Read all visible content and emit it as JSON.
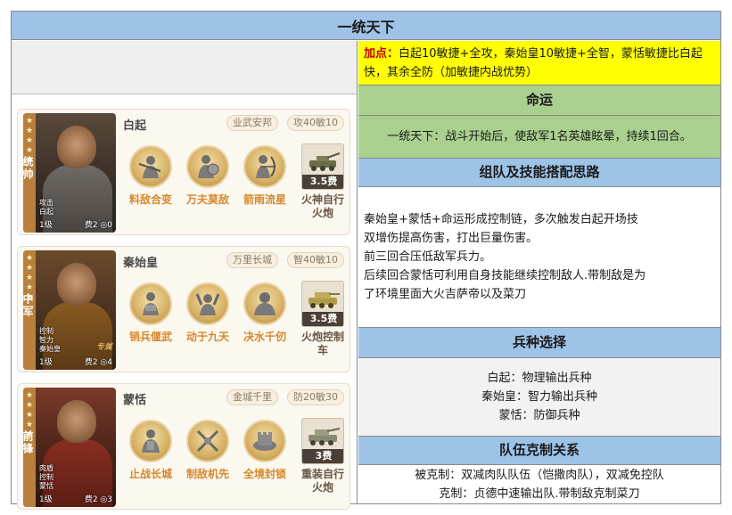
{
  "title": "一统天下",
  "right_panel": {
    "tip_prefix": "加点：",
    "tip_text": "白起10敏捷+全攻，秦始皇10敏捷+全智，蒙恬敏捷比白起快，其余全防（加敏捷内战优势）",
    "fate_header": "命运",
    "fate_text": "一统天下：战斗开始后，使敌军1名英雄眩晕，持续1回合。",
    "team_header": "组队及技能搭配思路",
    "team_lines": [
      "秦始皇+蒙恬+命运形成控制链，多次触发白起开场技",
      "双增伤提高伤害，打出巨量伤害。",
      "前三回合压低敌军兵力。",
      "后续回合蒙恬可利用自身技能继续控制敌人.带制敌是为",
      "了环境里面大火吉萨帝以及菜刀"
    ],
    "unit_header": "兵种选择",
    "unit_lines": [
      "白起：物理输出兵种",
      "秦始皇：智力输出兵种",
      "蒙恬：防御兵种"
    ],
    "counter_header": "队伍克制关系",
    "counter_lines": [
      "被克制：双减肉队队伍（恺撒肉队），双减免控队",
      "克制：贞德中速输出队.带制敌克制菜刀"
    ]
  },
  "heroes": [
    {
      "stars": "★\n★\n★\n★\n★",
      "role": "统帅",
      "portrait_text": "攻击\n白起",
      "level": "1级",
      "cost": "费2",
      "slot": "0",
      "tag": "",
      "name": "白起",
      "pill1": "业武安邦",
      "pill2": "攻40敏10",
      "skills": [
        "料敌合变",
        "万夫莫敌",
        "箭雨流星"
      ],
      "tank_cost": "3.5费",
      "tank_label": "火神自行火炮"
    },
    {
      "stars": "★\n★\n★\n★\n★",
      "role": "中军",
      "portrait_text": "控制\n智力\n秦始皇",
      "level": "1级",
      "cost": "费2",
      "slot": "4",
      "tag": "专属",
      "name": "秦始皇",
      "pill1": "万里长城",
      "pill2": "智40敏10",
      "skills": [
        "销兵偃武",
        "动于九天",
        "决水千仞"
      ],
      "tank_cost": "3.5费",
      "tank_label": "火炮控制车"
    },
    {
      "stars": "★\n★\n★\n★\n★",
      "role": "前锋",
      "portrait_text": "肉盾\n控制\n蒙恬",
      "level": "1级",
      "cost": "费2",
      "slot": "3",
      "tag": "",
      "name": "蒙恬",
      "pill1": "金城千里",
      "pill2": "防20敏30",
      "skills": [
        "止战长城",
        "制敌机先",
        "全境封锁"
      ],
      "tank_cost": "3费",
      "tank_label": "重装自行火炮"
    }
  ]
}
